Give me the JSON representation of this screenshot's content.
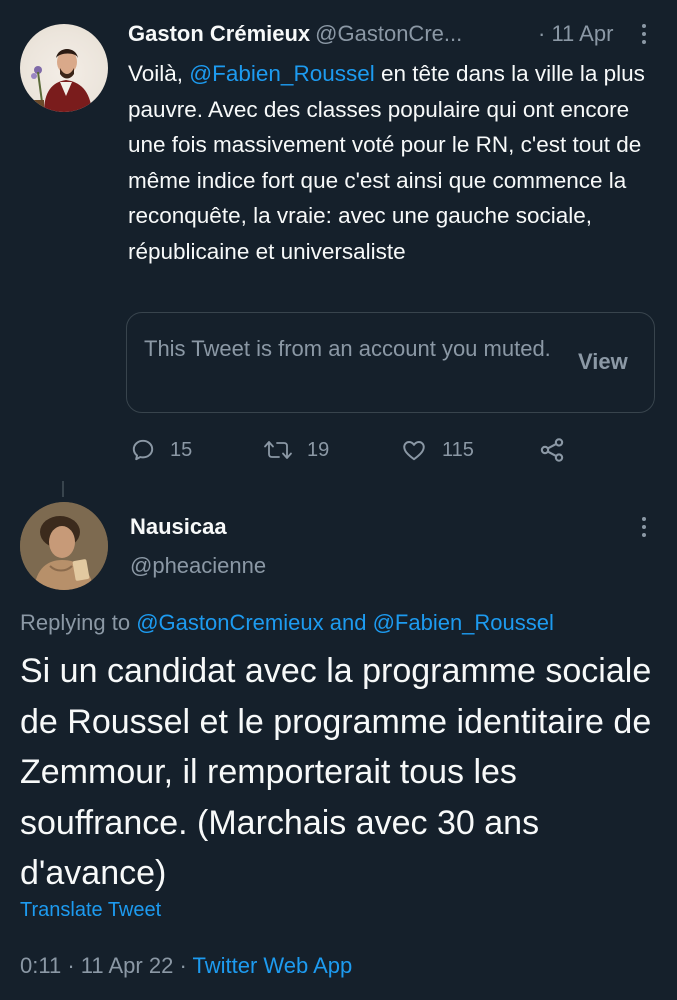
{
  "tweet1": {
    "author_name": "Gaston Crémieux",
    "author_handle": "@GastonCre...",
    "date": "· 11 Apr",
    "mention": "@Fabien_Roussel",
    "text_before": "Voilà, ",
    "text_after": " en tête dans la ville la plus pauvre. Avec des classes populaire qui ont encore une fois massivement voté pour le RN, c'est tout de même indice fort que c'est ainsi que commence la reconquête, la vraie: avec une gauche sociale, républicaine et universaliste",
    "muted_notice": "This Tweet is from an account you muted.",
    "view_label": "View",
    "actions": {
      "replies": "15",
      "retweets": "19",
      "likes": "115"
    }
  },
  "tweet2": {
    "author_name": "Nausicaa",
    "author_handle": "@pheacienne",
    "replying_prefix": "Replying to",
    "replying_user1": "@GastonCremieux",
    "replying_and": "and",
    "replying_user2": "@Fabien_Roussel",
    "text": "Si un candidat avec la programme sociale de Roussel et le programme identitaire de Zemmour, il remporterait tous les souffrance. (Marchais avec 30 ans d'avance)",
    "translate_label": "Translate Tweet",
    "time": "0:11",
    "date": "11 Apr 22",
    "separator": "·",
    "source": "Twitter Web App"
  },
  "colors": {
    "background": "#15202b",
    "text": "#f7f9f9",
    "muted": "#8b98a5",
    "link": "#1d9bf0",
    "border": "#38444d"
  },
  "icons": {
    "reply": "reply-icon",
    "retweet": "retweet-icon",
    "like": "like-icon",
    "share": "share-icon",
    "more": "more-options-icon"
  }
}
